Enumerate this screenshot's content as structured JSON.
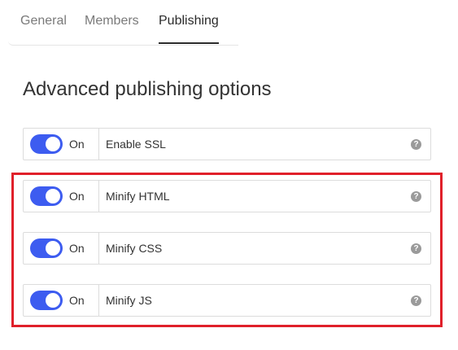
{
  "tabs": [
    {
      "label": "General"
    },
    {
      "label": "Members"
    },
    {
      "label": "Publishing",
      "active": true
    }
  ],
  "heading": "Advanced publishing options",
  "options": [
    {
      "toggle_state": "On",
      "label": "Enable SSL",
      "enabled": true,
      "help_glyph": "?"
    },
    {
      "toggle_state": "On",
      "label": "Minify HTML",
      "enabled": true,
      "help_glyph": "?"
    },
    {
      "toggle_state": "On",
      "label": "Minify CSS",
      "enabled": true,
      "help_glyph": "?"
    },
    {
      "toggle_state": "On",
      "label": "Minify JS",
      "enabled": true,
      "help_glyph": "?"
    }
  ],
  "colors": {
    "toggle_on": "#3d5cf0",
    "highlight": "#e0202a"
  },
  "icons": {
    "help": "question-circle-icon"
  }
}
